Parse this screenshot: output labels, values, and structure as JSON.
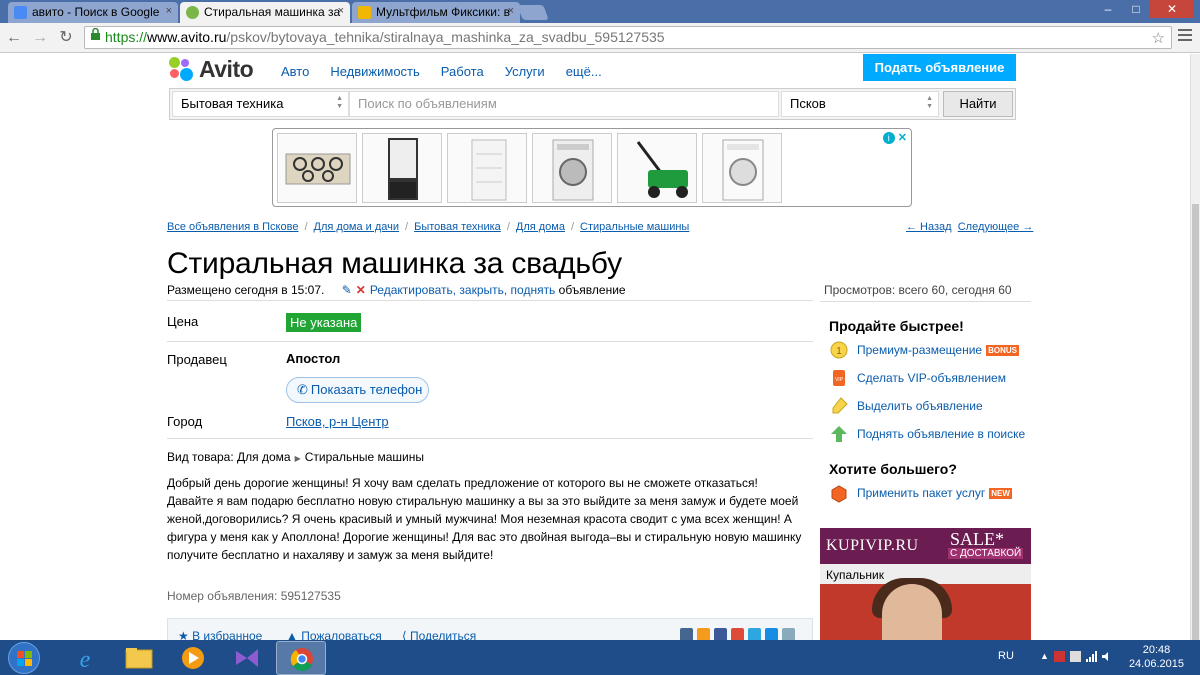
{
  "browser": {
    "tabs": [
      {
        "label": "авито - Поиск в Google",
        "close": "×"
      },
      {
        "label": "Стиральная машинка за",
        "close": "×"
      },
      {
        "label": "Мультфильм Фиксики: в",
        "close": "×"
      }
    ],
    "window_controls": {
      "minimize": "–",
      "maximize": "□",
      "close": "✕"
    },
    "back": "←",
    "forward": "→",
    "reload": "↻",
    "url_scheme": "https://",
    "url_domain": "www.avito.ru",
    "url_path": "/pskov/bytovaya_tehnika/stiralnaya_mashinka_za_svadbu_595127535",
    "star": "☆"
  },
  "header": {
    "logo_text": "Avito",
    "nav": [
      "Авто",
      "Недвижимость",
      "Работа",
      "Услуги",
      "ещё..."
    ],
    "post_ad": "Подать объявление"
  },
  "search": {
    "category": "Бытовая техника",
    "placeholder": "Поиск по объявлениям",
    "city": "Псков",
    "button": "Найти"
  },
  "ad_banner": {
    "info": "i",
    "close": "✕"
  },
  "breadcrumbs": [
    "Все объявления в Пскове",
    "Для дома и дачи",
    "Бытовая техника",
    "Для дома",
    "Стиральные машины"
  ],
  "prev_next": {
    "back": "← Назад",
    "next": "Следующее →"
  },
  "listing": {
    "title": "Стиральная машинка за свадьбу",
    "posted": "Размещено сегодня в 15:07.",
    "edit_links": "Редактировать, закрыть, поднять",
    "edit_suffix": "объявление",
    "views": "Просмотров: всего 60, сегодня 60",
    "price_label": "Цена",
    "price_value": "Не указана",
    "seller_label": "Продавец",
    "seller_name": "Апостол",
    "phone_button": "Показать телефон",
    "city_label": "Город",
    "city_value": "Псков, р-н Центр",
    "kind_label": "Вид товара: Для дома",
    "kind_sub": "Стиральные машины",
    "description": "Добрый день дорогие женщины! Я хочу вам сделать предложение от которого вы не сможете отказаться! Давайте я вам подарю бесплатно новую стиральную машинку а вы за это выйдите за меня замуж и будете моей женой,договорились? Я очень красивый и умный мужчина! Моя неземная красота сводит с ума всех женщин! А фигура у меня как у Аполлона! Дорогие женщины! Для вас это двойная выгода–вы и стиральную новую машинку получите бесплатно и нахаляву и замуж за меня выйдите!",
    "ad_number": "Номер объявления: 595127535",
    "actions": [
      "В избранное",
      "Пожаловаться",
      "Поделиться"
    ]
  },
  "sidebar": {
    "sell_faster": "Продайте быстрее!",
    "items": [
      {
        "label": "Премиум-размещение",
        "badge": "BONUS"
      },
      {
        "label": "Сделать VIP-объявлением",
        "badge": ""
      },
      {
        "label": "Выделить объявление",
        "badge": ""
      },
      {
        "label": "Поднять объявление в поиске",
        "badge": ""
      }
    ],
    "want_more": "Хотите большего?",
    "package": {
      "label": "Применить пакет услуг",
      "badge": "NEW"
    }
  },
  "promo": {
    "brand": "KUPIVIP.RU",
    "sale": "SALE*",
    "delivery": "С ДОСТАВКОЙ",
    "caption": "Купальник"
  },
  "taskbar": {
    "lang": "RU",
    "time": "20:48",
    "date": "24.06.2015"
  },
  "colors": {
    "link": "#0a5cad",
    "post_button": "#00aaff",
    "price_badge": "#21a534",
    "taskbar": "#1e4d8a"
  }
}
